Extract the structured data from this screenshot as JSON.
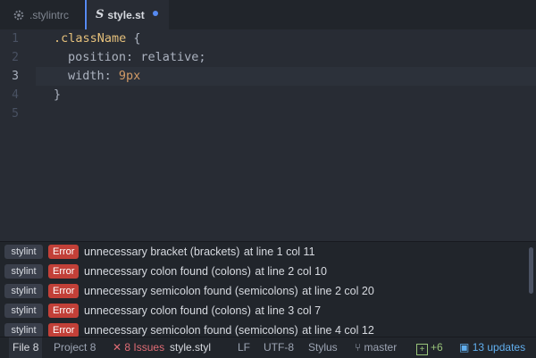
{
  "tabs": [
    {
      "label": ".stylintrc",
      "icon": "gear-icon",
      "active": false
    },
    {
      "label": "style.st",
      "icon": "stylus-file-icon",
      "active": true,
      "modified": true
    }
  ],
  "editor": {
    "line_numbers": [
      "1",
      "2",
      "3",
      "4",
      "5"
    ],
    "current_line": 3,
    "lines": [
      {
        "selector": ".className",
        "brace": " {"
      },
      {
        "property": "position",
        "colon": ":",
        "value": "relative",
        "semi": ";"
      },
      {
        "property": "width",
        "colon": ":",
        "value": "9px"
      },
      {
        "brace": "}"
      }
    ]
  },
  "linter": {
    "rows": [
      {
        "tool": "stylint",
        "severity": "Error",
        "message": "unnecessary bracket (brackets)",
        "location": "at line 1 col 11"
      },
      {
        "tool": "stylint",
        "severity": "Error",
        "message": "unnecessary colon found (colons)",
        "location": "at line 2 col 10"
      },
      {
        "tool": "stylint",
        "severity": "Error",
        "message": "unnecessary semicolon found (semicolons)",
        "location": "at line 2 col 20"
      },
      {
        "tool": "stylint",
        "severity": "Error",
        "message": "unnecessary colon found (colons)",
        "location": "at line 3 col 7"
      },
      {
        "tool": "stylint",
        "severity": "Error",
        "message": "unnecessary semicolon found (semicolons)",
        "location": "at line 4 col 12"
      }
    ]
  },
  "statusbar": {
    "file_tab": "File",
    "file_count": "8",
    "project_tab": "Project",
    "project_count": "8",
    "issues": "8 Issues",
    "filename": "style.styl",
    "line_ending": "LF",
    "encoding": "UTF-8",
    "grammar": "Stylus",
    "branch": "master",
    "git_added": "+6",
    "updates": "13 updates"
  },
  "colors": {
    "background": "#282c34",
    "accent": "#568af2",
    "error": "#c24038",
    "selector": "#e5c07b",
    "number": "#d19a66"
  }
}
